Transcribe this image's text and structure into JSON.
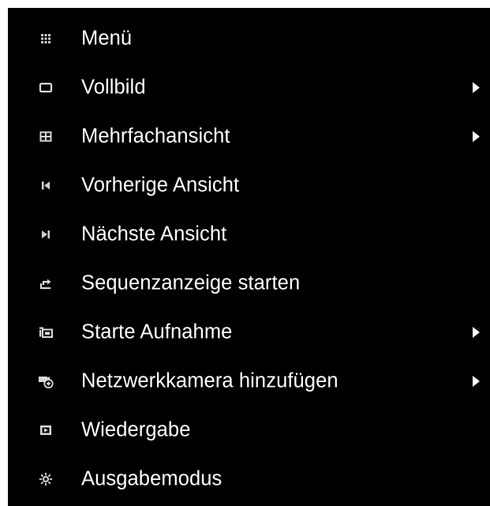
{
  "menu": {
    "items": [
      {
        "label": "Menü",
        "icon": "grid-icon",
        "submenu": false
      },
      {
        "label": "Vollbild",
        "icon": "fullscreen-icon",
        "submenu": true
      },
      {
        "label": "Mehrfachansicht",
        "icon": "multi-view-icon",
        "submenu": true
      },
      {
        "label": "Vorherige Ansicht",
        "icon": "previous-icon",
        "submenu": false
      },
      {
        "label": "Nächste Ansicht",
        "icon": "next-icon",
        "submenu": false
      },
      {
        "label": "Sequenzanzeige starten",
        "icon": "sequence-icon",
        "submenu": false
      },
      {
        "label": "Starte Aufnahme",
        "icon": "record-icon",
        "submenu": true
      },
      {
        "label": "Netzwerkkamera hinzufügen",
        "icon": "add-camera-icon",
        "submenu": true
      },
      {
        "label": "Wiedergabe",
        "icon": "playback-icon",
        "submenu": false
      },
      {
        "label": "Ausgabemodus",
        "icon": "output-mode-icon",
        "submenu": false
      }
    ]
  },
  "colors": {
    "background": "#000000",
    "text": "#ffffff",
    "icon": "#cfcfcf"
  }
}
